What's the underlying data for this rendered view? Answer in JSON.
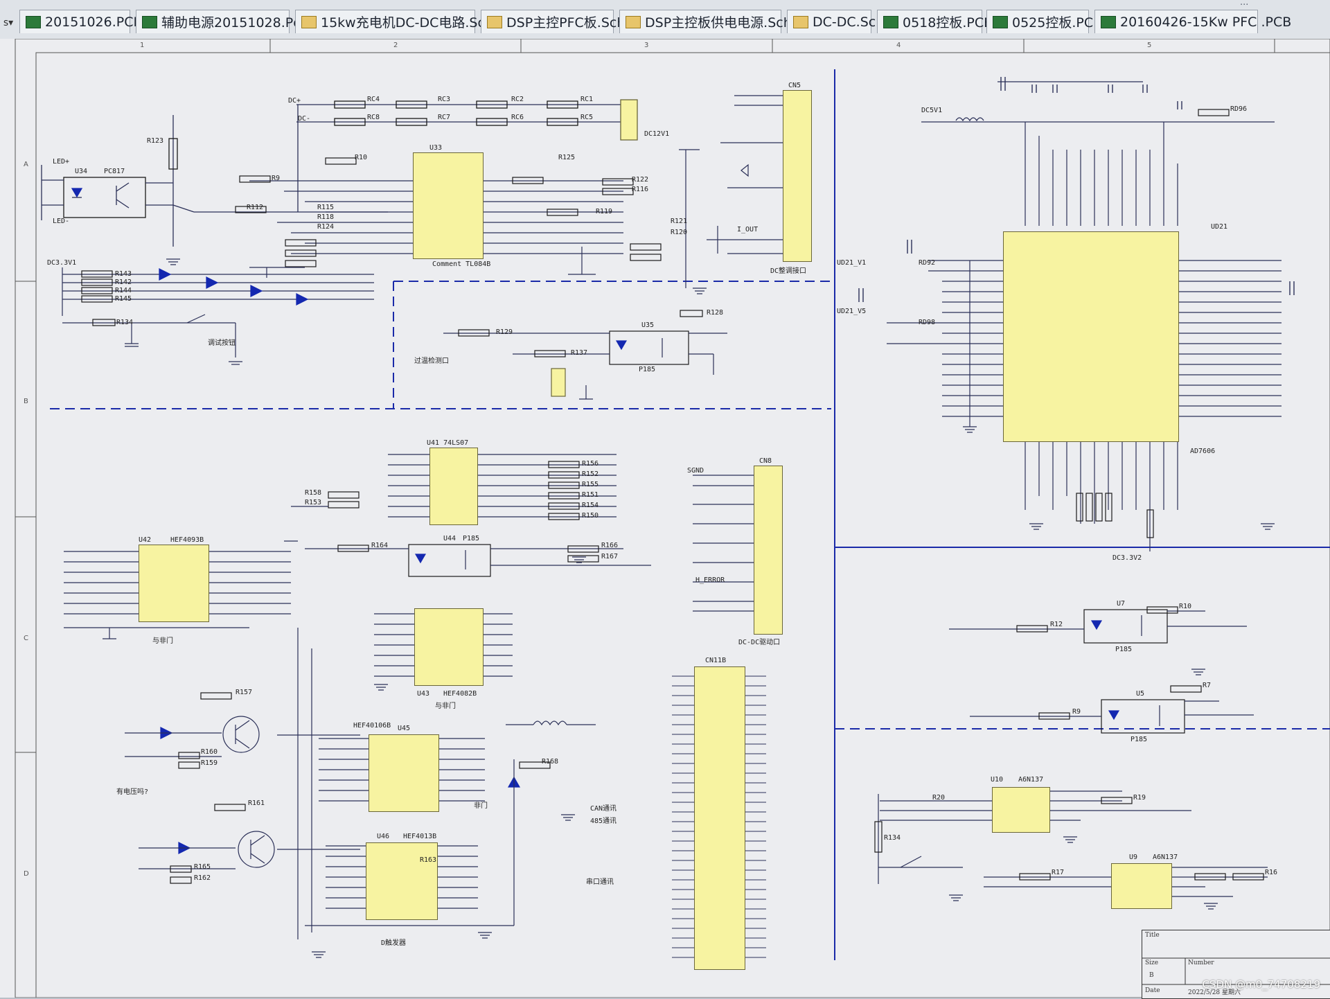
{
  "tabs": [
    {
      "label": "20151026.PCB",
      "type": "pcb"
    },
    {
      "label": "辅助电源20151028.Pcb",
      "type": "pcb"
    },
    {
      "label": "15kw充电机DC-DC电路.Sch",
      "type": "sch"
    },
    {
      "label": "DSP主控PFC板.Sch",
      "type": "sch"
    },
    {
      "label": "DSP主控板供电电源.Sch",
      "type": "sch"
    },
    {
      "label": "DC-DC.Sch",
      "type": "sch"
    },
    {
      "label": "0518控板.PCB",
      "type": "pcb"
    },
    {
      "label": "0525控板.PCB",
      "type": "pcb"
    },
    {
      "label": "20160426-15Kw PFC .PCB",
      "type": "pcb"
    }
  ],
  "tab_dropdown": "s",
  "zones": {
    "cols": [
      "1",
      "2",
      "3",
      "4",
      "5"
    ],
    "rows": [
      "A",
      "B",
      "C",
      "D"
    ]
  },
  "chips": {
    "u33": {
      "ref": "U33",
      "part": "Comment  TL084B"
    },
    "cn5": {
      "ref": "CN5",
      "caption": "DC整调接口"
    },
    "u41": {
      "ref": "U41  74LS07"
    },
    "u42": {
      "ref": "U42",
      "part": "HEF4093B",
      "caption": "与非门"
    },
    "u43": {
      "ref": "U43",
      "part": "HEF4082B",
      "caption": "与门"
    },
    "u45": {
      "ref": "U45",
      "part": "HEF40106B"
    },
    "u46": {
      "ref": "U46",
      "part": "HEF4013B",
      "caption": "D触发器"
    },
    "cn8": {
      "ref": "CN8",
      "caption": "DC-DC驱动口"
    },
    "cn11b": {
      "ref": "CN11B"
    },
    "ud21": {
      "ref": "UD21",
      "part": "AD7606"
    },
    "u10": {
      "ref": "U10",
      "part": "A6N137"
    },
    "u9": {
      "ref": "U9",
      "part": "A6N137"
    }
  },
  "opto": [
    {
      "ref": "U34",
      "part": "PC817"
    },
    {
      "ref": "U35",
      "part": "P185"
    },
    {
      "ref": "U44",
      "part": "P185"
    },
    {
      "ref": "U7",
      "part": "P185"
    },
    {
      "ref": "U5",
      "part": "P185"
    }
  ],
  "nets": {
    "dc_plus": "DC+",
    "dc_minus": "DC-",
    "dc12v1": "DC12V1",
    "dc3v3": "DC3.3V1",
    "dc5v1": "DC5V1",
    "dc3v3v2": "DC3.3V2",
    "sgnd": "SGND",
    "led_plus": "LED+",
    "led_minus": "LED-",
    "h_error": "H_ERROR",
    "i_out": "I_OUT",
    "ud21_v1": "UD21_V1",
    "ud21_v5": "UD21_V5"
  },
  "annotations": {
    "test_sw": "调试按钮",
    "temp_detect": "过温检测口",
    "can_comm": "CAN通讯",
    "rs485": "485通讯",
    "serial": "串口通讯",
    "fault": "有电压吗?",
    "nand": "非门"
  },
  "resistors": [
    "RC4",
    "RC3",
    "RC2",
    "RC1",
    "RC8",
    "RC7",
    "RC6",
    "RC5",
    "R123",
    "R9",
    "R10",
    "R115",
    "R118",
    "R124",
    "R112",
    "R122",
    "R116",
    "R119",
    "R121",
    "R120",
    "R125",
    "R143",
    "R142",
    "R144",
    "R145",
    "R134",
    "R129",
    "R137",
    "R128",
    "R158",
    "R153",
    "R156",
    "R152",
    "R155",
    "R151",
    "R154",
    "R150",
    "R164",
    "R166",
    "R167",
    "R157",
    "R160",
    "R159",
    "R161",
    "R165",
    "R162",
    "R168",
    "R163",
    "RD96",
    "RD92",
    "RD98",
    "R12",
    "R10",
    "R9",
    "R7",
    "R20",
    "R134",
    "R19",
    "R17",
    "R16"
  ],
  "title_block": {
    "title_label": "Title",
    "size_label": "Size",
    "number_label": "Number",
    "size_value": "B",
    "date_label": "Date",
    "date_value": "2022/5/28 星期六"
  },
  "watermark": "CSDN @m0_74708219",
  "colors": {
    "chip_fill": "#f7f3a1",
    "wire": "#2a2f57",
    "divider": "#1a2aa8",
    "led": "#1428b0",
    "sheet": "#ecedf0"
  }
}
